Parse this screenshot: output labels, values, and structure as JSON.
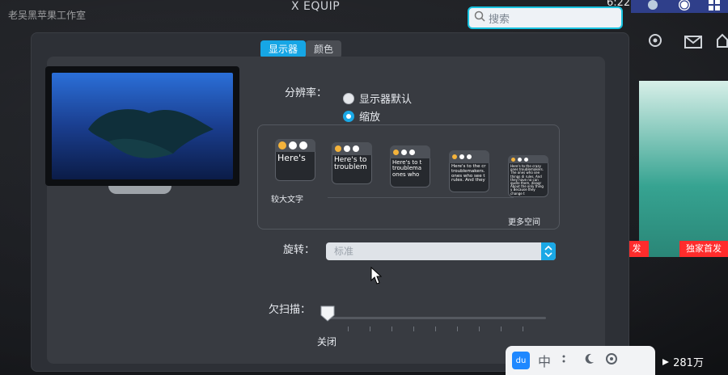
{
  "watermark": "老吴黑苹果工作室",
  "window": {
    "title": "X EQUIP",
    "top_time": "6:22"
  },
  "search": {
    "placeholder": "搜索"
  },
  "tabs": [
    {
      "label": "显示器",
      "active": true
    },
    {
      "label": "颜色",
      "active": false
    }
  ],
  "display": {
    "resolution_label": "分辨率：",
    "resolution_options": [
      {
        "label": "显示器默认",
        "selected": false
      },
      {
        "label": "缩放",
        "selected": true
      }
    ],
    "scale_samples": [
      "Here's",
      "Here's to troublem",
      "Here's to t troublema ones who",
      "Here's to the cr troublemakers. ones who see t rules. And they",
      "Here's to the crazy ones troublemakers. The ones who see things di rules. And they have no can quote them, disagr About the only thing y Because they change t"
    ],
    "scale_left_label": "较大文字",
    "scale_right_label": "更多空间",
    "rotation_label": "旋转：",
    "rotation_value": "标准",
    "underscan_label": "欠扫描：",
    "underscan_value_label": "关闭",
    "underscan_level": 0
  },
  "background_right": {
    "badge_left": "发",
    "badge_right": "独家首发",
    "view_count": "281万"
  },
  "ime": {
    "logo": "du",
    "lang": "中"
  },
  "icons": {
    "search": "search-icon",
    "gear": "gear-icon",
    "mail": "mail-icon",
    "home": "home-icon",
    "stepper": "chevron-updown-icon",
    "slider": "slider-knob-icon",
    "cursor": "cursor-icon",
    "moon": "moon-icon",
    "settings": "settings-icon",
    "play": "play-icon"
  },
  "colors": {
    "accent": "#16a6e5",
    "sheet": "#2d3036",
    "panel": "#383b41",
    "badge": "#ff2c2c",
    "search_border": "#18c3e0"
  }
}
